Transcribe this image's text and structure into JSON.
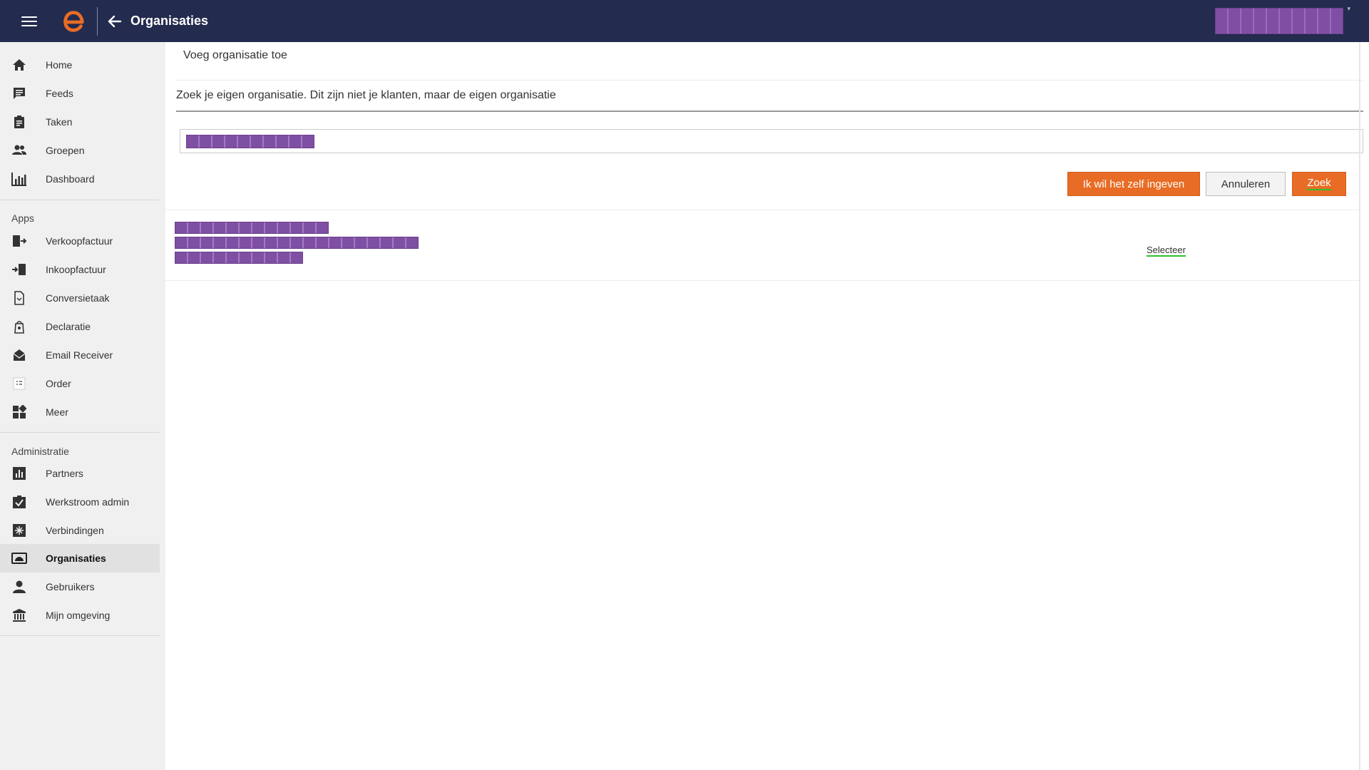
{
  "topbar": {
    "title": "Organisaties",
    "menu_icon": "hamburger-menu-icon",
    "back_icon": "arrow-left-icon",
    "logo_color": "#e86c25",
    "background": "#232b4e"
  },
  "sidebar": {
    "main_items": [
      {
        "label": "Home",
        "icon": "home-icon"
      },
      {
        "label": "Feeds",
        "icon": "chat-icon"
      },
      {
        "label": "Taken",
        "icon": "clipboard-icon"
      },
      {
        "label": "Groepen",
        "icon": "people-icon"
      },
      {
        "label": "Dashboard",
        "icon": "chart-icon"
      }
    ],
    "apps_heading": "Apps",
    "app_items": [
      {
        "label": "Verkoopfactuur",
        "icon": "invoice-out-icon"
      },
      {
        "label": "Inkoopfactuur",
        "icon": "invoice-in-icon"
      },
      {
        "label": "Conversietaak",
        "icon": "document-convert-icon"
      },
      {
        "label": "Declaratie",
        "icon": "receipt-icon"
      },
      {
        "label": "Email Receiver",
        "icon": "mail-icon"
      },
      {
        "label": "Order",
        "icon": "order-icon"
      },
      {
        "label": "Meer",
        "icon": "widgets-icon"
      }
    ],
    "admin_heading": "Administratie",
    "admin_items": [
      {
        "label": "Partners",
        "icon": "bar-chart-icon"
      },
      {
        "label": "Werkstroom admin",
        "icon": "checkbox-icon"
      },
      {
        "label": "Verbindingen",
        "icon": "connections-icon"
      },
      {
        "label": "Organisaties",
        "icon": "organisation-icon",
        "active": true
      },
      {
        "label": "Gebruikers",
        "icon": "user-icon"
      },
      {
        "label": "Mijn omgeving",
        "icon": "bank-icon"
      }
    ]
  },
  "main": {
    "heading": "Voeg organisatie toe",
    "intro": "Zoek je eigen organisatie. Dit zijn niet je klanten, maar de eigen organisatie",
    "buttons": {
      "manual": "Ik wil het zelf ingeven",
      "cancel": "Annuleren",
      "search": "Zoek"
    },
    "result": {
      "select_label": "Selecteer"
    }
  },
  "colors": {
    "accent": "#e86c25",
    "redaction": "#7e4fa3",
    "focus_underline": "#2ec02e"
  }
}
